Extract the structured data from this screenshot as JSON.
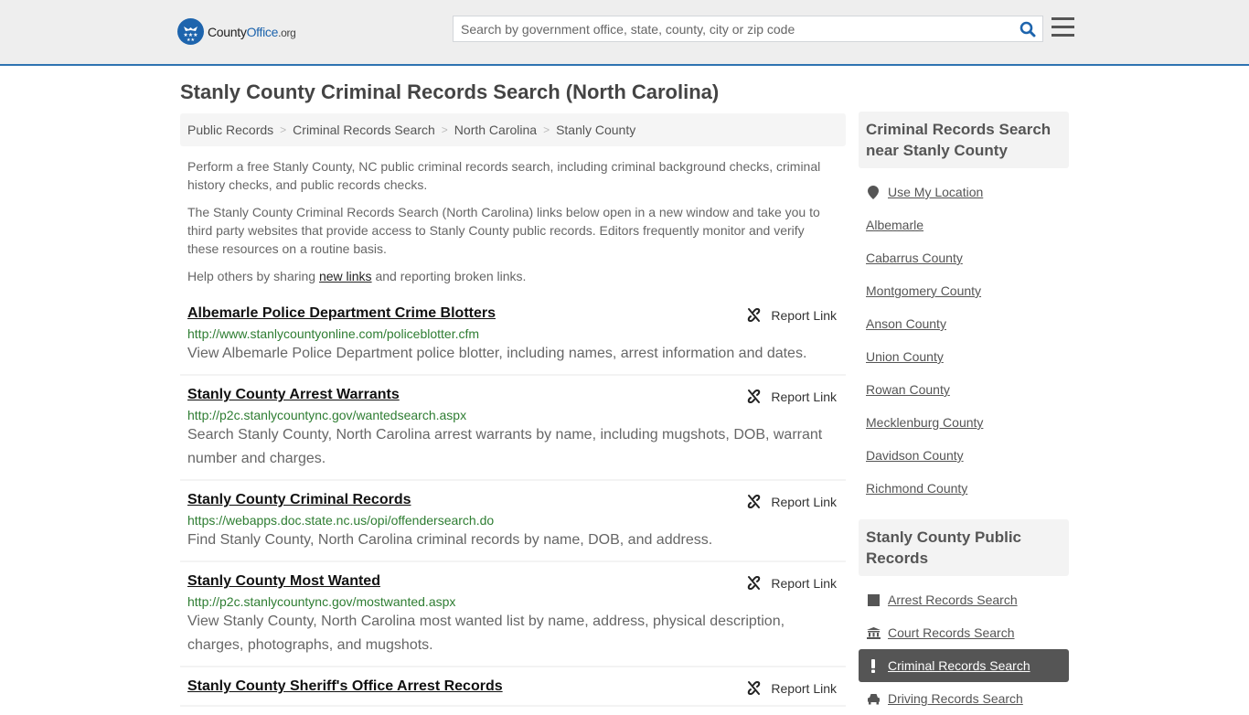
{
  "header": {
    "logo": {
      "county": "County",
      "office": "Office",
      "org": ".org"
    },
    "search": {
      "placeholder": "Search by government office, state, county, city or zip code",
      "value": ""
    }
  },
  "page": {
    "title": "Stanly County Criminal Records Search (North Carolina)"
  },
  "breadcrumb": [
    {
      "label": "Public Records"
    },
    {
      "label": "Criminal Records Search"
    },
    {
      "label": "North Carolina"
    },
    {
      "label": "Stanly County"
    }
  ],
  "intro": {
    "p1": "Perform a free Stanly County, NC public criminal records search, including criminal background checks, criminal history checks, and public records checks.",
    "p2": "The Stanly County Criminal Records Search (North Carolina) links below open in a new window and take you to third party websites that provide access to Stanly County public records. Editors frequently monitor and verify these resources on a routine basis.",
    "p3_before": "Help others by sharing ",
    "p3_link": "new links",
    "p3_after": " and reporting broken links."
  },
  "report_label": "Report Link",
  "listings": [
    {
      "title": "Albemarle Police Department Crime Blotters",
      "url": "http://www.stanlycountyonline.com/policeblotter.cfm",
      "desc": "View Albemarle Police Department police blotter, including names, arrest information and dates."
    },
    {
      "title": "Stanly County Arrest Warrants",
      "url": "http://p2c.stanlycountync.gov/wantedsearch.aspx",
      "desc": "Search Stanly County, North Carolina arrest warrants by name, including mugshots, DOB, warrant number and charges."
    },
    {
      "title": "Stanly County Criminal Records",
      "url": "https://webapps.doc.state.nc.us/opi/offendersearch.do",
      "desc": "Find Stanly County, North Carolina criminal records by name, DOB, and address."
    },
    {
      "title": "Stanly County Most Wanted",
      "url": "http://p2c.stanlycountync.gov/mostwanted.aspx",
      "desc": "View Stanly County, North Carolina most wanted list by name, address, physical description, charges, photographs, and mugshots."
    },
    {
      "title": "Stanly County Sheriff's Office Arrest Records",
      "url": "",
      "desc": ""
    }
  ],
  "sidebar": {
    "nearby": {
      "heading": "Criminal Records Search near Stanly County",
      "use_location": "Use My Location",
      "items": [
        "Albemarle",
        "Cabarrus County",
        "Montgomery County",
        "Anson County",
        "Union County",
        "Rowan County",
        "Mecklenburg County",
        "Davidson County",
        "Richmond County"
      ]
    },
    "public_records": {
      "heading": "Stanly County Public Records",
      "items": [
        {
          "label": "Arrest Records Search",
          "icon": "square-icon",
          "active": false
        },
        {
          "label": "Court Records Search",
          "icon": "courthouse-icon",
          "active": false
        },
        {
          "label": "Criminal Records Search",
          "icon": "exclamation-icon",
          "active": true
        },
        {
          "label": "Driving Records Search",
          "icon": "car-icon",
          "active": false
        }
      ]
    }
  },
  "colors": {
    "brand": "#1d64ad",
    "accent_bar": "#2e73b1",
    "url_green": "#2e7d32",
    "active_bg": "#555555"
  }
}
